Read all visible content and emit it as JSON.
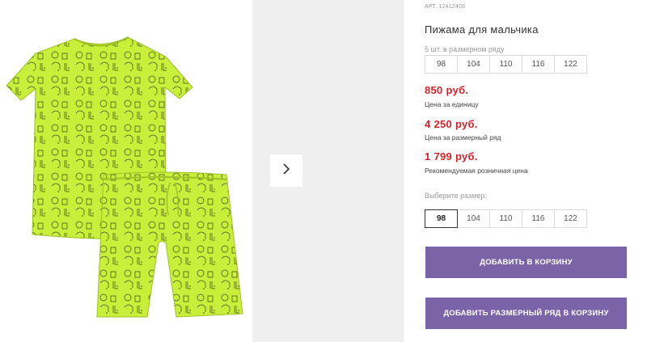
{
  "product": {
    "sku": "АРТ. 12412408",
    "title": "Пижама для мальчика",
    "pack_note": "5 шт. в размерном ряду",
    "size_row": [
      "98",
      "104",
      "110",
      "116",
      "122"
    ]
  },
  "prices": [
    {
      "value": "850 руб.",
      "label": "Цена за единицу"
    },
    {
      "value": "4 250 руб.",
      "label": "Цена за размерный ряд"
    },
    {
      "value": "1 799 руб.",
      "label": "Рекомендуемая розничная цена"
    }
  ],
  "size_select": {
    "label": "Выберите размер:",
    "options": [
      "98",
      "104",
      "110",
      "116",
      "122"
    ],
    "selected": "98"
  },
  "actions": {
    "add_to_cart": "ДОБАВИТЬ В КОРЗИНУ",
    "add_size_row": "ДОБАВИТЬ РАЗМЕРНЫЙ РЯД В КОРЗИНУ"
  },
  "colors": {
    "price": "#d8232a",
    "button": "#7b63a7",
    "product": "#c8f03a"
  },
  "icons": {
    "gallery_next": "chevron-right-icon"
  }
}
